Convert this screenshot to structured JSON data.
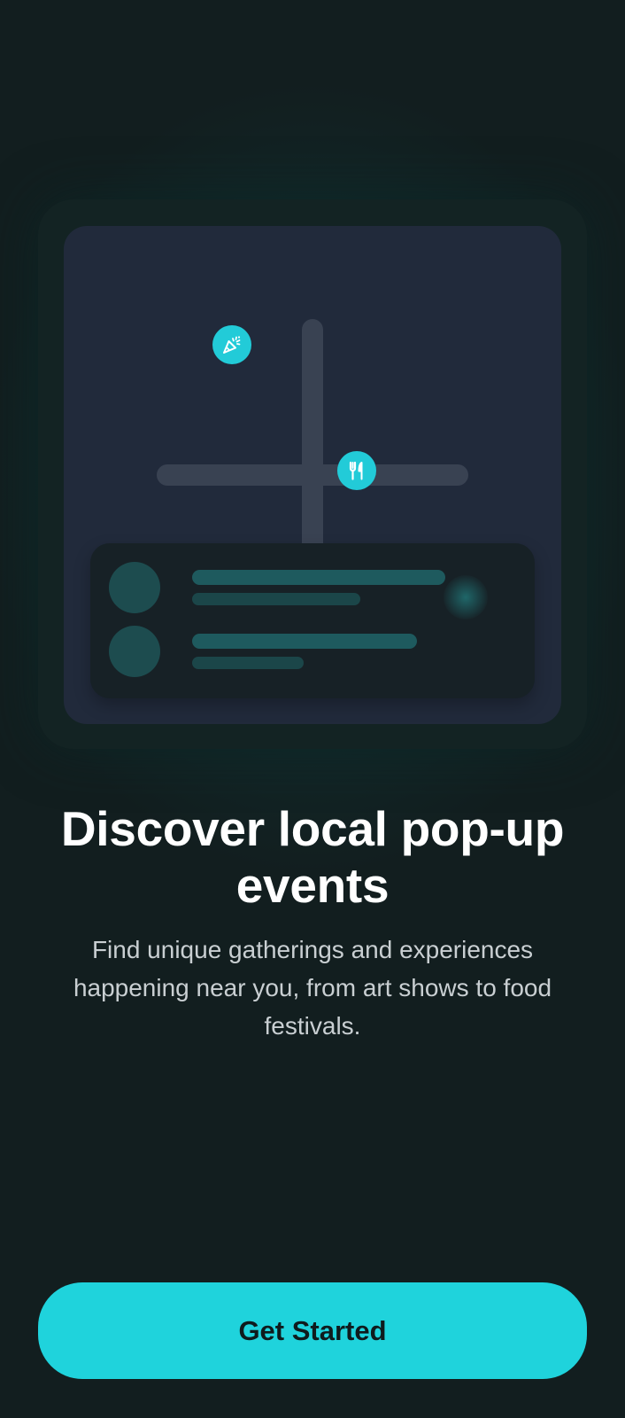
{
  "onboarding": {
    "title": "Discover local pop-up events",
    "description": "Find unique gatherings and experiences happening near you, from art shows to food festivals.",
    "cta_label": "Get Started"
  },
  "illustration": {
    "pins": [
      {
        "icon": "party-popper-icon"
      },
      {
        "icon": "fork-knife-icon"
      }
    ]
  },
  "colors": {
    "accent": "#1fd3dc",
    "background": "#121e1f",
    "map": "#212a3b"
  }
}
